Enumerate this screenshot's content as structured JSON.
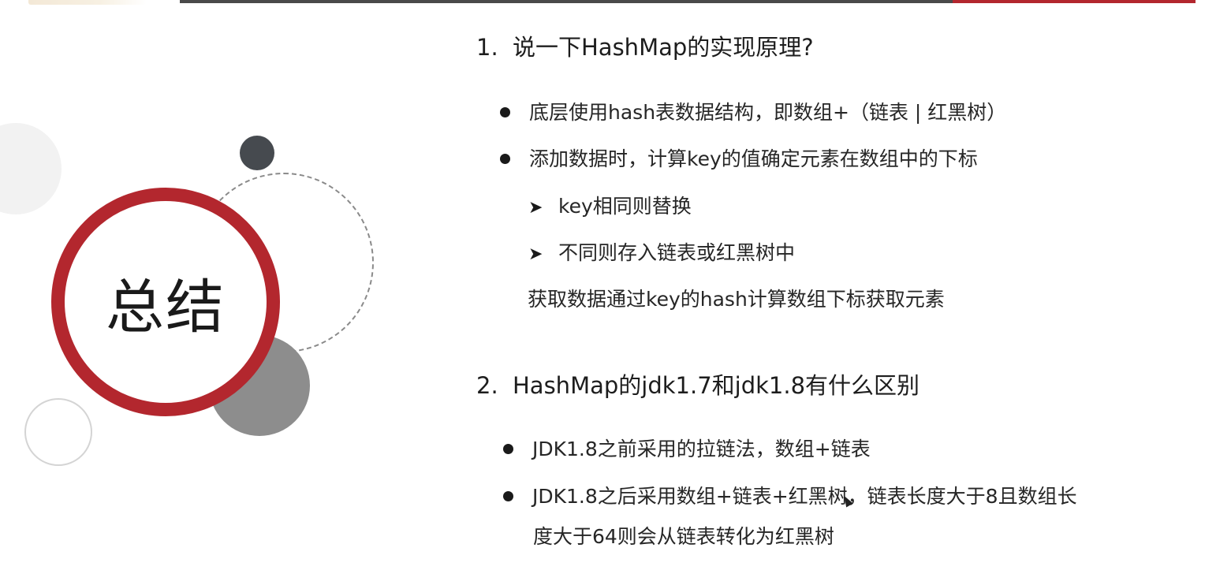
{
  "slide": {
    "summary_title": "总结",
    "q1": {
      "number": "1.",
      "title": "说一下HashMap的实现原理?",
      "bullets": [
        "底层使用hash表数据结构，即数组+（链表 | 红黑树）",
        "添加数据时，计算key的值确定元素在数组中的下标"
      ],
      "sub_items": [
        "key相同则替换",
        "不同则存入链表或红黑树中"
      ],
      "note": "获取数据通过key的hash计算数组下标获取元素"
    },
    "q2": {
      "number": "2.",
      "title": "HashMap的jdk1.7和jdk1.8有什么区别",
      "bullets": [
        "JDK1.8之前采用的拉链法，数组+链表",
        "JDK1.8之后采用数组+链表+红黑树，链表长度大于8且数组长"
      ],
      "bullet_continuation": "度大于64则会从链表转化为红黑树"
    }
  },
  "icons": {
    "bullet": "filled-circle-bullet",
    "sub_bullet": "arrowhead-bullet",
    "pointer": "mouse-cursor-icon"
  },
  "colors": {
    "accent_red": "#b3272e",
    "dark_gray": "#464a4f",
    "mid_gray": "#8d8d8d"
  }
}
